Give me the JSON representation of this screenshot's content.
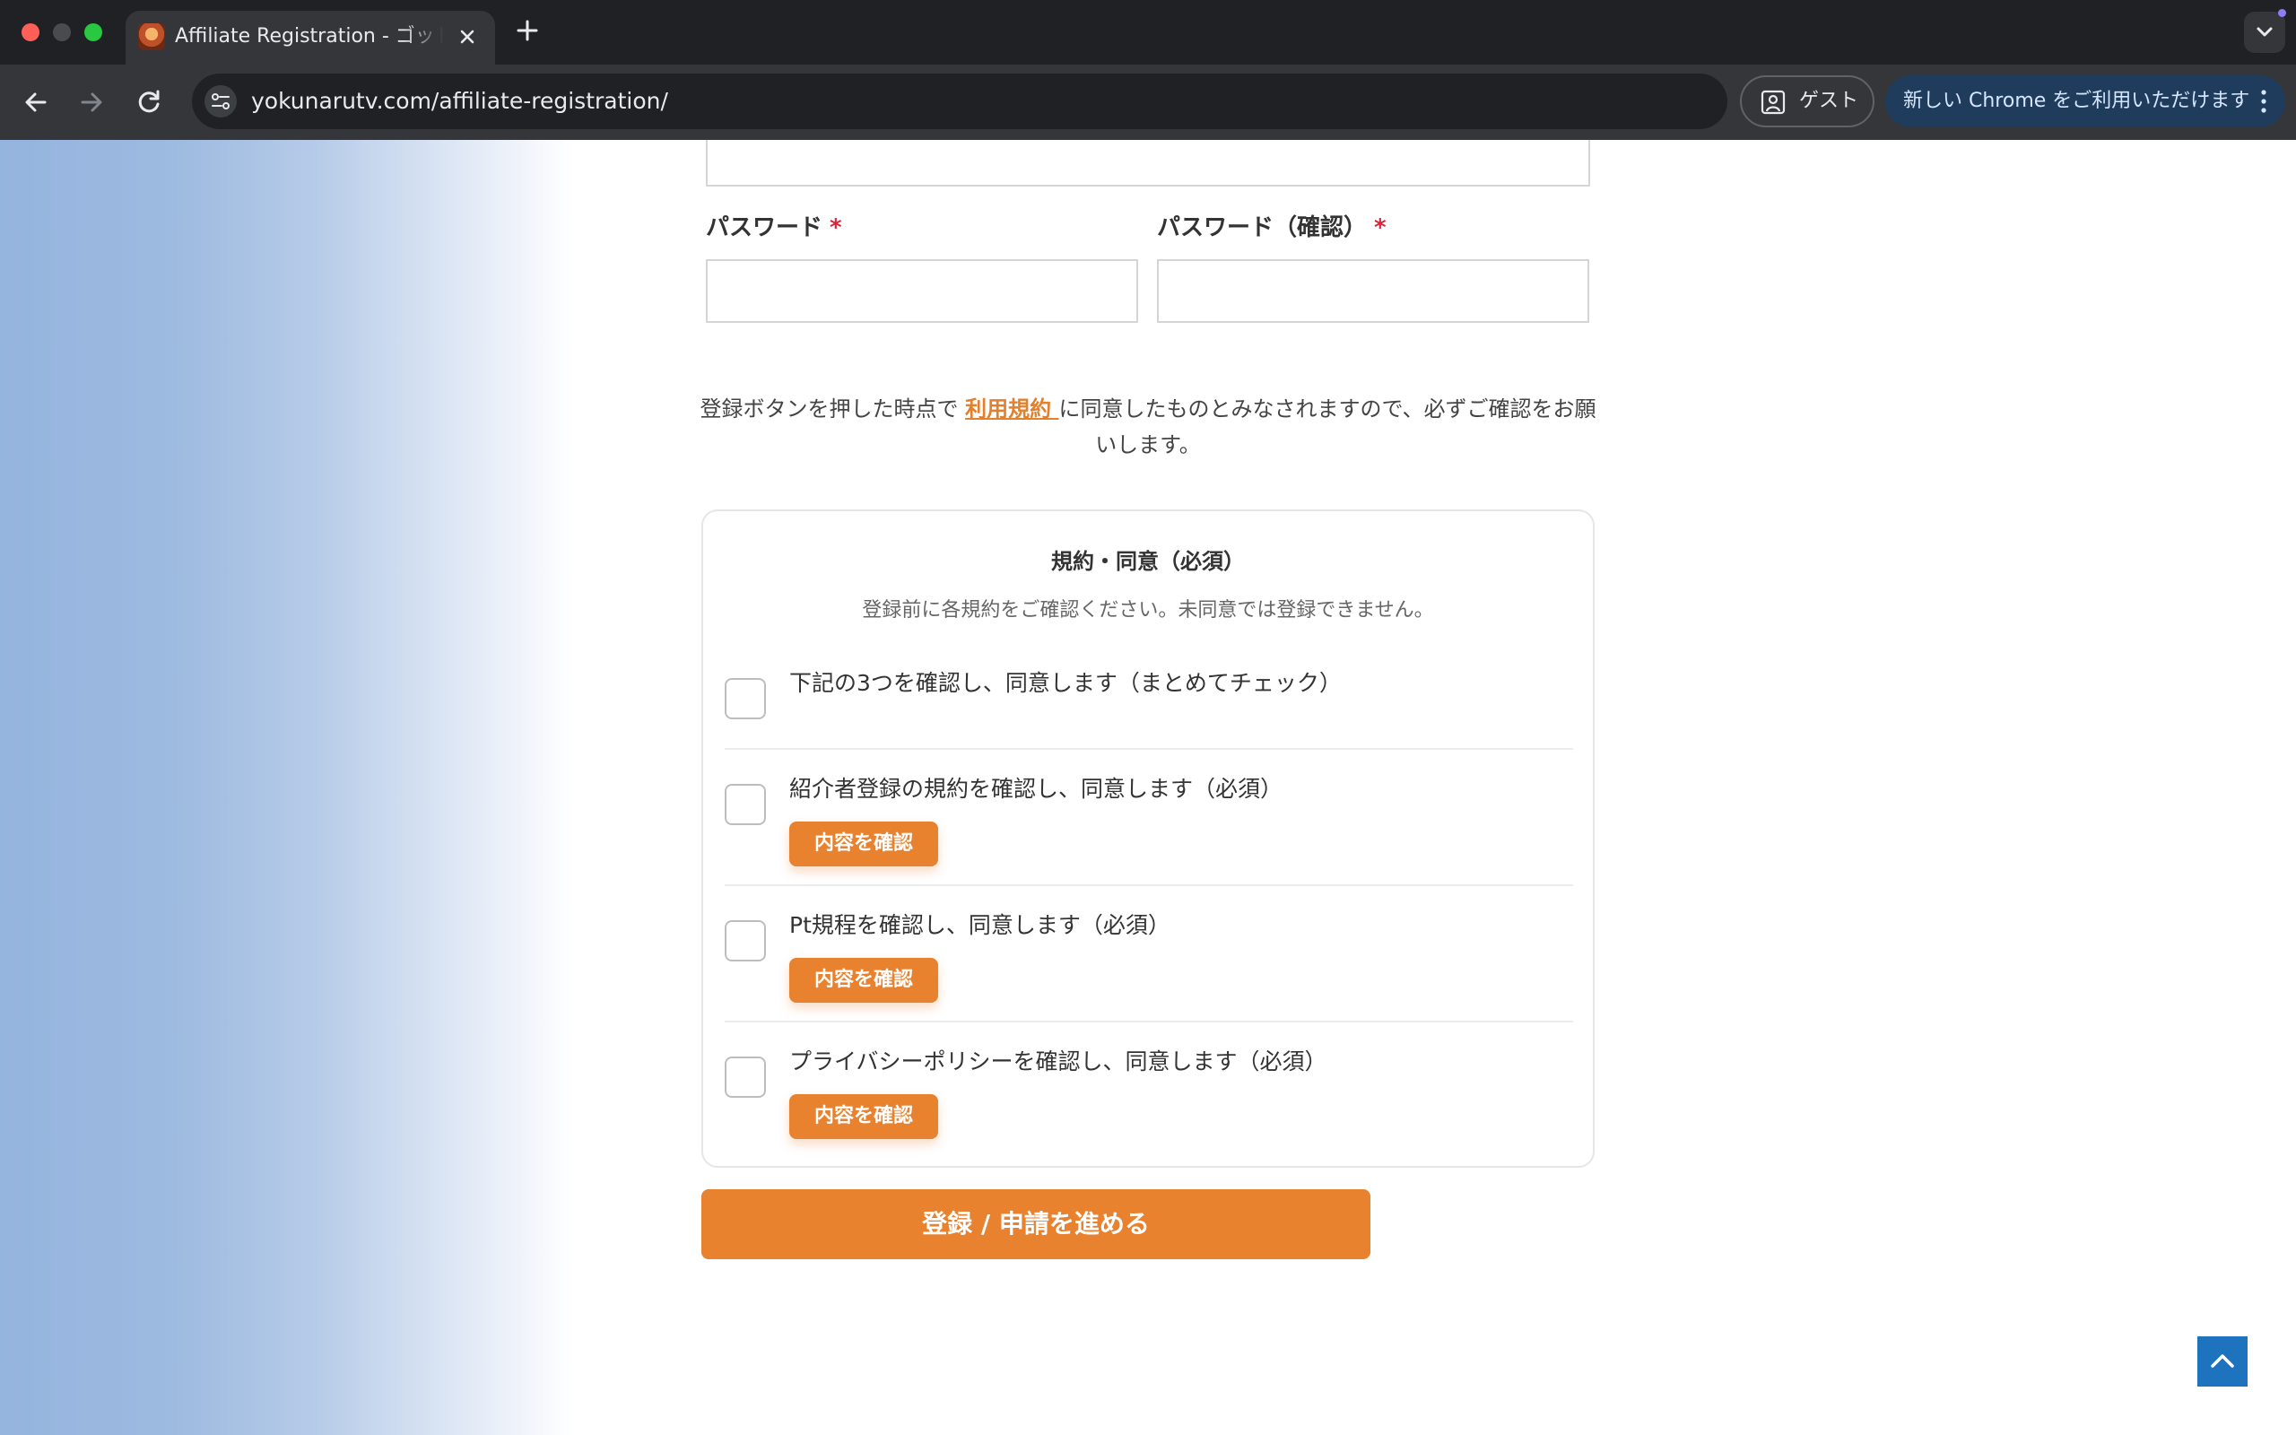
{
  "browser": {
    "tab": {
      "title": "Affiliate Registration - ゴッドハンドTV"
    },
    "address_bar": {
      "url": "yokunarutv.com/affiliate-registration/"
    },
    "guest_chip": {
      "label": "ゲスト"
    },
    "update_chip": {
      "label": "新しい Chrome をご利用いただけます"
    }
  },
  "form": {
    "password": {
      "label": "パスワード",
      "required_mark": "*"
    },
    "password_confirm": {
      "label": "パスワード（確認）",
      "required_mark": "*"
    },
    "notice": {
      "before": "登録ボタンを押した時点で ",
      "link_text": "利用規約 ",
      "after": "に同意したものとみなされますので、必ずご確認をお願いします。"
    }
  },
  "agreement": {
    "title": "規約・同意（必須）",
    "subtitle": "登録前に各規約をご確認ください。未同意では登録できません。",
    "items": [
      {
        "label": "下記の3つを確認し、同意します（まとめてチェック）",
        "checked": false
      },
      {
        "label": "紹介者登録の規約を確認し、同意します（必須）",
        "button": "内容を確認",
        "checked": false
      },
      {
        "label": "Pt規程を確認し、同意します（必須）",
        "button": "内容を確認",
        "checked": false
      },
      {
        "label": "プライバシーポリシーを確認し、同意します（必須）",
        "button": "内容を確認",
        "checked": false
      }
    ]
  },
  "submit": {
    "label": "登録 / 申請を進める"
  },
  "colors": {
    "accent": "#e8822f",
    "required": "#d6263b",
    "back_to_top": "#1e73be"
  }
}
